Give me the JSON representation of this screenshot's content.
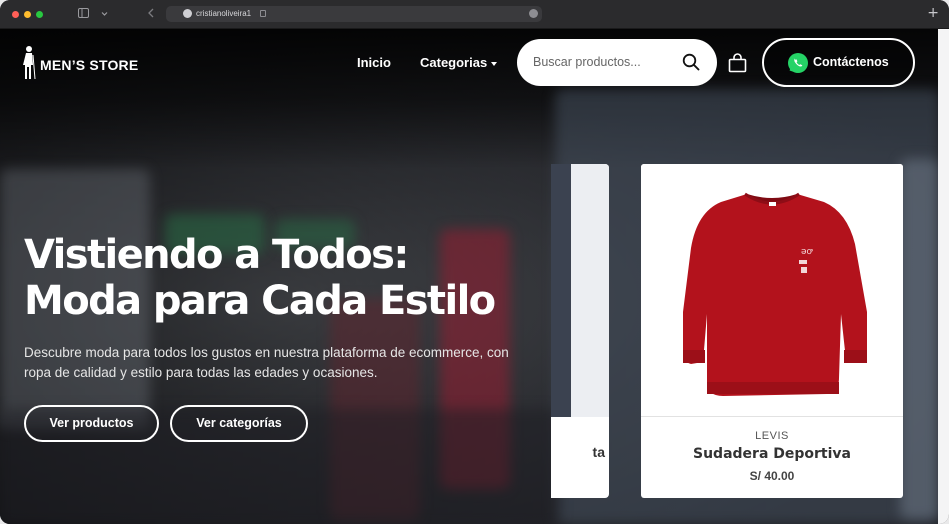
{
  "browser": {
    "url": "cristianoliveira1",
    "icons": [
      "close-dot",
      "minimize-dot",
      "maximize-dot",
      "sidebar-icon",
      "chevron-down-icon",
      "back-icon",
      "github-icon",
      "lock-icon",
      "reload-icon",
      "new-tab-icon"
    ],
    "new_tab": "+"
  },
  "navbar": {
    "brand": "MEN’S STORE",
    "links": [
      {
        "label": "Inicio"
      },
      {
        "label": "Categorias"
      }
    ],
    "search_placeholder": "Buscar productos...",
    "contact_label": "Contáctenos",
    "colors": {
      "whatsapp": "#25d366"
    }
  },
  "hero": {
    "title_line1": "Vistiendo a Todos:",
    "title_line2": "Moda para Cada Estilo",
    "description_line1": "Descubre moda para todos los gustos en nuestra plataforma de ecommerce, con",
    "description_line2": "ropa de calidad y estilo para todas las edades y ocasiones.",
    "buttons": [
      {
        "label": "Ver productos"
      },
      {
        "label": "Ver categorías"
      }
    ]
  },
  "carousel": {
    "partial_card": {
      "name_fragment": "ta"
    },
    "card": {
      "brand": "LEVIS",
      "name": "Sudadera Deportiva",
      "price": "S/ 40.00",
      "image_color": "#b3121c"
    }
  }
}
